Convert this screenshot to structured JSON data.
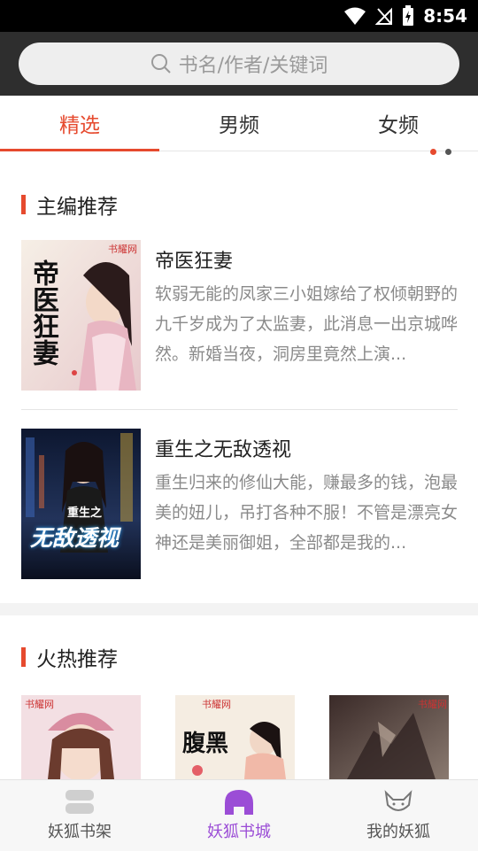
{
  "status_bar": {
    "time": "8:54",
    "icons": [
      "wifi-icon",
      "no-signal-icon",
      "battery-charging-icon"
    ]
  },
  "search": {
    "placeholder": "书名/作者/关键词",
    "icon": "search-icon"
  },
  "tabs": [
    {
      "label": "精选",
      "active": true
    },
    {
      "label": "男频",
      "active": false
    },
    {
      "label": "女频",
      "active": false
    }
  ],
  "carousel": {
    "dot_colors": [
      "#e64a2e",
      "#555555"
    ]
  },
  "editor_picks": {
    "title": "主编推荐",
    "books": [
      {
        "title": "帝医狂妻",
        "description": "软弱无能的凤家三小姐嫁给了权倾朝野的九千岁成为了太监妻，此消息一出京城哗然。新婚当夜，洞房里竟然上演...",
        "cover_text": "帝医狂妻",
        "cover_publisher": "书耀网"
      },
      {
        "title": "重生之无敌透视",
        "description": "重生归来的修仙大能，赚最多的钱，泡最美的妞儿，吊打各种不服！不管是漂亮女神还是美丽御姐，全部都是我的...",
        "cover_text": "无敌透视",
        "cover_subtext": "重生之"
      }
    ]
  },
  "hot_picks": {
    "title": "火热推荐",
    "covers": [
      {
        "publisher": "书耀网"
      },
      {
        "publisher": "书耀网",
        "cover_text": "腹黑"
      },
      {
        "publisher": "书耀网"
      }
    ]
  },
  "bottom_nav": [
    {
      "label": "妖狐书架",
      "icon": "bookshelf-icon",
      "active": false
    },
    {
      "label": "妖狐书城",
      "icon": "bookstore-icon",
      "active": true
    },
    {
      "label": "我的妖狐",
      "icon": "fox-profile-icon",
      "active": false
    }
  ],
  "colors": {
    "accent": "#e64a2e",
    "active_nav": "#9b4dd6",
    "topbar": "#2e2e2e"
  }
}
